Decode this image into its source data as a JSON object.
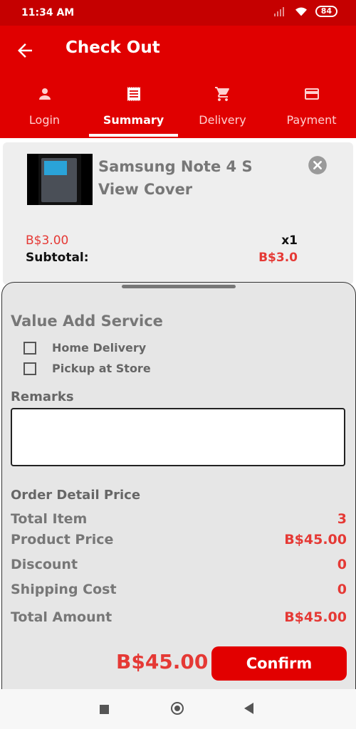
{
  "status_bar": {
    "time": "11:34 AM",
    "battery": "84"
  },
  "header": {
    "title": "Check Out"
  },
  "tabs": [
    {
      "label": "Login",
      "icon": "person-icon"
    },
    {
      "label": "Summary",
      "icon": "receipt-icon"
    },
    {
      "label": "Delivery",
      "icon": "cart-icon"
    },
    {
      "label": "Payment",
      "icon": "credit-card-icon"
    }
  ],
  "active_tab": "Summary",
  "cart_item": {
    "name": "Samsung Note 4 S View Cover",
    "unit_price": "B$3.00",
    "quantity": "x1",
    "subtotal_label": "Subtotal:",
    "subtotal_value": "B$3.0"
  },
  "value_add": {
    "title": "Value Add Service",
    "options": [
      {
        "label": "Home Delivery",
        "checked": false
      },
      {
        "label": "Pickup at Store",
        "checked": false
      }
    ]
  },
  "remarks": {
    "label": "Remarks",
    "value": ""
  },
  "order_detail": {
    "title": "Order Detail Price",
    "rows": [
      {
        "label": "Total Item",
        "value": "3"
      },
      {
        "label": "Product Price",
        "value": "B$45.00"
      },
      {
        "label": "Discount",
        "value": "0"
      },
      {
        "label": "Shipping Cost",
        "value": "0"
      },
      {
        "label": "Total Amount",
        "value": "B$45.00"
      }
    ]
  },
  "footer": {
    "total": "B$45.00",
    "confirm_label": "Confirm"
  },
  "colors": {
    "primary": "#e00000",
    "status_bar": "#c50000",
    "price": "#e53935"
  }
}
